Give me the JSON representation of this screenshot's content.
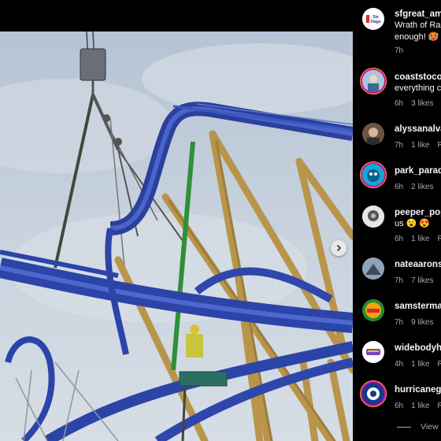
{
  "post": {
    "next_label": "Next",
    "view_replies": "View"
  },
  "comments": [
    {
      "user": "sfgreat_ame",
      "text_lines": [
        "Wrath of Ra",
        "enough!"
      ],
      "emoji": "🥵",
      "time": "7h",
      "likes": "",
      "reply": ""
    },
    {
      "user": "coaststocoa",
      "text_lines": [
        "everything c"
      ],
      "time": "6h",
      "likes": "3 likes",
      "reply": "R"
    },
    {
      "user": "alyssanalvar",
      "text_lines": [],
      "time": "7h",
      "likes": "1 like",
      "reply": "Re"
    },
    {
      "user": "park_paradi",
      "text_lines": [],
      "time": "6h",
      "likes": "2 likes",
      "reply": "R"
    },
    {
      "user": "peeper_pop",
      "text_lines": [
        "us 😮 😍"
      ],
      "time": "6h",
      "likes": "1 like",
      "reply": "Re"
    },
    {
      "user": "nateaaronsc",
      "text_lines": [],
      "time": "7h",
      "likes": "7 likes",
      "reply": "R"
    },
    {
      "user": "samstermac",
      "text_lines": [],
      "time": "7h",
      "likes": "9 likes",
      "reply": "R"
    },
    {
      "user": "widebodyhe",
      "text_lines": [],
      "time": "4h",
      "likes": "1 like",
      "reply": "Re"
    },
    {
      "user": "hurricanegp",
      "text_lines": [],
      "time": "6h",
      "likes": "1 like",
      "reply": "Re"
    }
  ],
  "avatars": {
    "six_flags_text": "Six Flags"
  }
}
